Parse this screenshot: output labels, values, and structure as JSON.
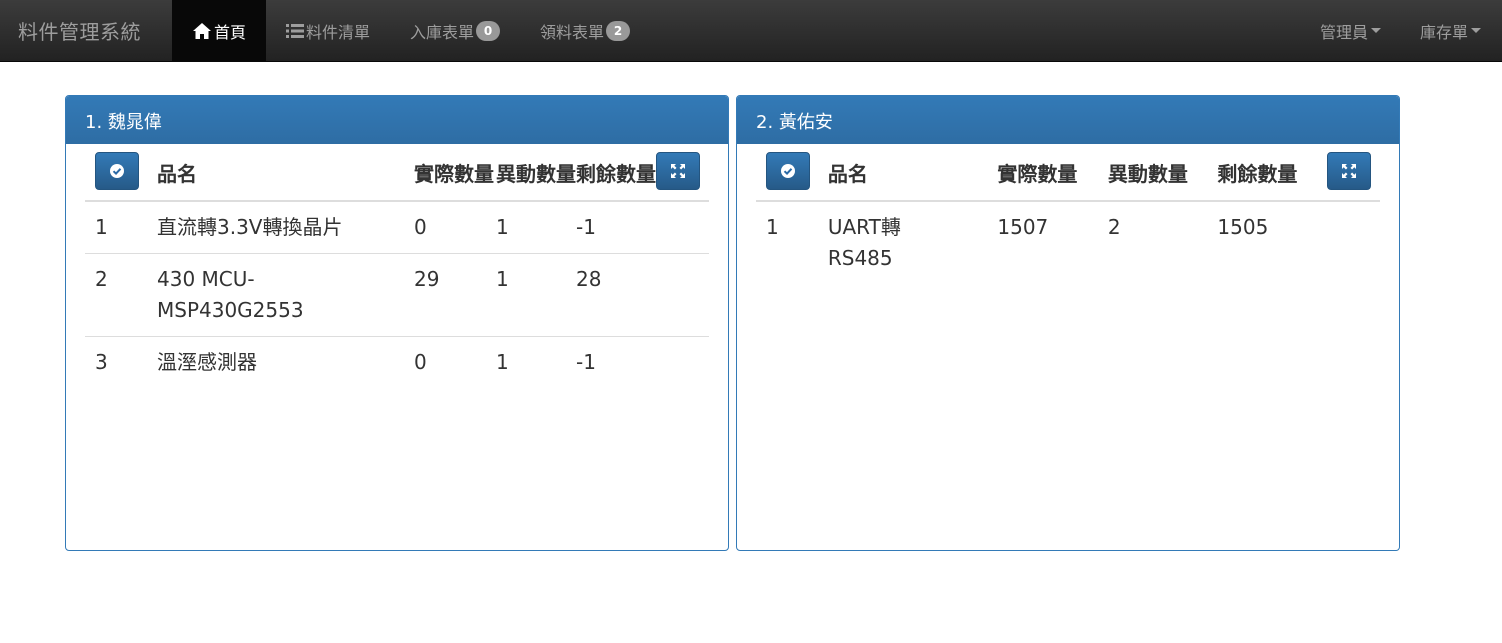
{
  "app": {
    "brand": "料件管理系統"
  },
  "nav": {
    "home": "首頁",
    "parts_list": "料件清單",
    "inbound": "入庫表單",
    "inbound_count": "0",
    "requisition": "領料表單",
    "requisition_count": "2",
    "admin": "管理員",
    "inventory": "庫存單"
  },
  "colors": {
    "navbar": "#222222",
    "panel_primary": "#337ab7",
    "badge": "#999999"
  },
  "panels": [
    {
      "title": "1. 魏晁偉",
      "headers": {
        "name": "品名",
        "actual": "實際數量",
        "change": "異動數量",
        "remaining": "剩餘數量"
      },
      "rows": [
        {
          "idx": "1",
          "name": "直流轉3.3V轉換晶片",
          "actual": "0",
          "change": "1",
          "remaining": "-1"
        },
        {
          "idx": "2",
          "name": "430 MCU-MSP430G2553",
          "actual": "29",
          "change": "1",
          "remaining": "28"
        },
        {
          "idx": "3",
          "name": "溫溼感測器",
          "actual": "0",
          "change": "1",
          "remaining": "-1"
        }
      ]
    },
    {
      "title": "2. 黃佑安",
      "headers": {
        "name": "品名",
        "actual": "實際數量",
        "change": "異動數量",
        "remaining": "剩餘數量"
      },
      "rows": [
        {
          "idx": "1",
          "name": "UART轉 RS485",
          "actual": "1507",
          "change": "2",
          "remaining": "1505"
        }
      ]
    }
  ]
}
